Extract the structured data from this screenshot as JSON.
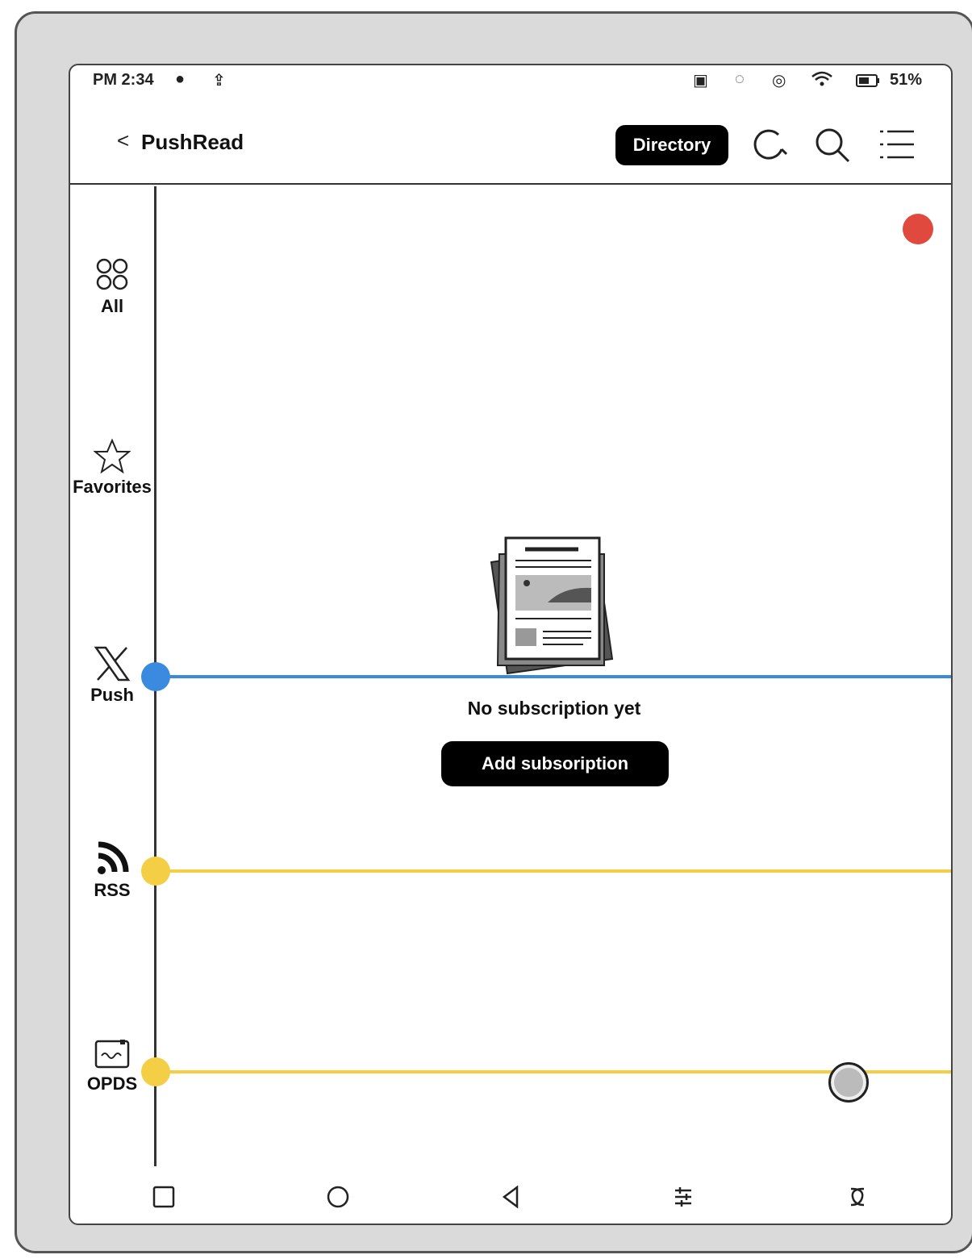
{
  "status_bar": {
    "time": "PM 2:34",
    "battery": "51%"
  },
  "header": {
    "title": "PushRead",
    "directory_label": "Directory"
  },
  "sidebar": {
    "items": [
      {
        "label": "All",
        "icon": "four-circles-icon"
      },
      {
        "label": "Favorites",
        "icon": "star-icon"
      },
      {
        "label": "Push",
        "icon": "x-logo-icon"
      },
      {
        "label": "RSS",
        "icon": "rss-icon"
      },
      {
        "label": "OPDS",
        "icon": "opds-icon"
      }
    ]
  },
  "main": {
    "empty_message": "No subscription yet",
    "add_button_label": "Add subsoription"
  },
  "colors": {
    "marker_blue": "#3a8be0",
    "marker_yellow": "#f4cf45",
    "badge_red": "#e04a3e"
  }
}
